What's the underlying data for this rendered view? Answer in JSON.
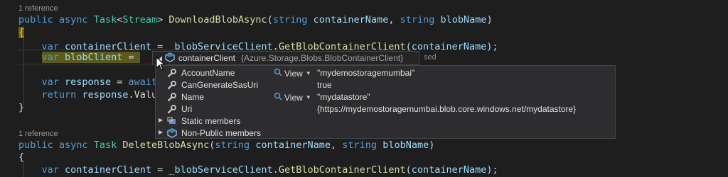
{
  "code": {
    "ref1": "1 reference",
    "l1": {
      "public": "public",
      "async": "async",
      "task": "Task",
      "lt": "<",
      "stream": "Stream",
      "gt": ">",
      "fn": "DownloadBlobAsync",
      "open": "(",
      "string1": "string",
      "p1": "containerName",
      "comma": ",",
      "string2": "string",
      "p2": "blobName",
      "close": ")"
    },
    "l2": "{",
    "l3": {
      "var": "var",
      "name": "containerClient",
      "eq": " = ",
      "field": "_blobServiceClient",
      "dot": ".",
      "method": "GetBlobContainerClient",
      "arg": "(containerName);"
    },
    "l4": {
      "var": "var",
      "name": "blobClient",
      "eq": " = "
    },
    "ghost": "sed",
    "l5": {
      "var": "var",
      "name": "response",
      "eq": " = ",
      "await": "await"
    },
    "l6": {
      "ret": "return",
      "name": "response",
      "rest": ".Valu"
    },
    "l7": "}",
    "ref2": "1 reference",
    "l8": {
      "public": "public",
      "async": "async",
      "task": "Task",
      "fn": "DeleteBlobAsync",
      "open": "(",
      "string1": "string",
      "p1": "containerName",
      "comma": ",",
      "string2": "string",
      "p2": "blobName",
      "close": ")"
    },
    "l9": "{",
    "l10": {
      "var": "var",
      "name": "containerClient",
      "eq": " = ",
      "field": "_blobServiceClient",
      "dot": ".",
      "method": "GetBlobContainerClient",
      "arg": "(containerName);"
    }
  },
  "datatip": {
    "header_name": "containerClient",
    "header_type": "{Azure.Storage.Blobs.BlobContainerClient}",
    "rows": [
      {
        "name": "AccountName",
        "icon": "wrench-icon",
        "viewer": "View",
        "value": "\"mydemostoragemumbai\""
      },
      {
        "name": "CanGenerateSasUri",
        "icon": "wrench-icon",
        "viewer": "",
        "value": "true"
      },
      {
        "name": "Name",
        "icon": "wrench-icon",
        "viewer": "View",
        "value": "\"mydatastore\""
      },
      {
        "name": "Uri",
        "icon": "wrench-icon",
        "viewer": "",
        "value": "{https://mydemostoragemumbai.blob.core.windows.net/mydatastore}"
      },
      {
        "name": "Static members",
        "icon": "static-members-icon",
        "viewer": "",
        "value": ""
      },
      {
        "name": "Non-Public members",
        "icon": "non-public-members-icon",
        "viewer": "",
        "value": ""
      }
    ]
  },
  "colors": {
    "keyword": "#569cd6",
    "type": "#4ec9b0",
    "method": "#dcdcaa",
    "variable": "#9cdcfe",
    "text": "#d4d4d4",
    "background": "#1e1e1e"
  }
}
